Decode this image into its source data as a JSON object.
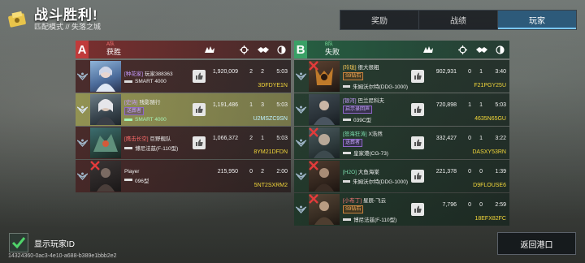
{
  "header": {
    "title": "战斗胜利!",
    "subtitle": "匹配模式 // 失落之城"
  },
  "tabs": [
    {
      "label": "奖励",
      "active": false
    },
    {
      "label": "战绩",
      "active": false
    },
    {
      "label": "玩家",
      "active": true
    }
  ],
  "team_a": {
    "letter": "A",
    "name": "A队",
    "result": "获胜",
    "players": [
      {
        "guild": "[种花家]",
        "name": "玩家388363",
        "tag": "",
        "ship": "SMART 4000",
        "damage": "1,920,009",
        "kills": "2",
        "assists": "2",
        "time": "5:03",
        "id": "3DFDYE1N",
        "dead": false,
        "me": false
      },
      {
        "guild": "[史诗]",
        "name": "残影随行",
        "tag": "送葬者",
        "ship": "SMART 4000",
        "damage": "1,191,486",
        "kills": "1",
        "assists": "3",
        "time": "5:03",
        "id": "U2MSZC9SN",
        "dead": false,
        "me": true
      },
      {
        "guild": "[鹰击长空]",
        "name": "巨野舰队",
        "tag": "",
        "ship": "博尼法兹(F-110型)",
        "damage": "1,066,372",
        "kills": "2",
        "assists": "1",
        "time": "5:03",
        "id": "8YM21DFDN",
        "dead": false,
        "me": false
      },
      {
        "guild": "",
        "name": "Player",
        "tag": "",
        "ship": "096型",
        "damage": "215,950",
        "kills": "0",
        "assists": "2",
        "time": "2:00",
        "id": "5NT2SXRM2",
        "dead": true,
        "me": false
      }
    ]
  },
  "team_b": {
    "letter": "B",
    "name": "B队",
    "result": "失败",
    "players": [
      {
        "guild": "[玲珑]",
        "name": "很大很粗",
        "tag": "S9钻石",
        "tag_color": "orange",
        "ship": "朱姆沃尔特(DDG-1000)",
        "damage": "902,931",
        "kills": "0",
        "assists": "1",
        "time": "3:40",
        "id": "F21PGY25U",
        "dead": true
      },
      {
        "guild": "[银河]",
        "name": "巴兰尼科夫",
        "tag": "启示录回声",
        "tag_color": "purple",
        "ship": "039C型",
        "damage": "720,898",
        "kills": "1",
        "assists": "1",
        "time": "5:03",
        "id": "4635N65GU",
        "dead": false
      },
      {
        "guild": "[怒海狂涛]",
        "name": "X浩然",
        "tag": "送葬者",
        "tag_color": "purple",
        "ship": "皇家港(CG-73)",
        "damage": "332,427",
        "kills": "0",
        "assists": "1",
        "time": "3:22",
        "id": "DASXY53RN",
        "dead": true
      },
      {
        "guild": "[H2O]",
        "name": "大鱼海棠",
        "tag": "",
        "tag_color": "",
        "ship": "朱姆沃尔特(DDG-1000)",
        "damage": "221,378",
        "kills": "0",
        "assists": "0",
        "time": "1:39",
        "id": "D9FLOUSE6",
        "dead": true
      },
      {
        "guild": "[小布丁]",
        "name": "星辰-飞云",
        "tag": "S9钻石",
        "tag_color": "orange",
        "ship": "博尼法兹(F-110型)",
        "damage": "7,796",
        "kills": "0",
        "assists": "0",
        "time": "2:59",
        "id": "18EFX82FC",
        "dead": true
      }
    ]
  },
  "footer": {
    "show_id_label": "显示玩家ID",
    "show_id_checked": true,
    "return_label": "返回港口",
    "uid": "14324360-0ac3-4e10-a688-b389e1bbb2e2"
  },
  "colors": {
    "team_a": "#c03b3b",
    "team_b": "#3aa066",
    "id_yellow": "#f4d83a",
    "active_tab": "#2d5a7a"
  },
  "icons": {
    "header": "trophy-icon",
    "stat_columns": [
      "damage-icon",
      "kills-crosshair-icon",
      "assist-handshake-icon",
      "survival-time-icon"
    ],
    "row_rank": "rank-insignia-icon",
    "row_like": "thumbs-up-icon",
    "row_dead": "destroyed-x-icon"
  }
}
